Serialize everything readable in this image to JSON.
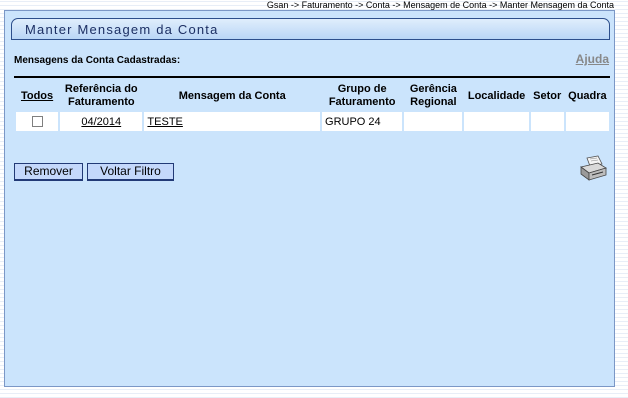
{
  "breadcrumb": "Gsan -> Faturamento -> Conta -> Mensagem de Conta -> Manter Mensagem da Conta",
  "title": "Manter Mensagem da Conta",
  "section_label": "Mensagens da Conta Cadastradas:",
  "help_label": "Ajuda",
  "table": {
    "headers": {
      "todos": "Todos",
      "referencia_1": "Referência do",
      "referencia_2": "Faturamento",
      "mensagem": "Mensagem da Conta",
      "grupo_1": "Grupo de",
      "grupo_2": "Faturamento",
      "gerencia_1": "Gerência",
      "gerencia_2": "Regional",
      "localidade": "Localidade",
      "setor": "Setor",
      "quadra": "Quadra"
    },
    "rows": [
      {
        "checked": false,
        "referencia": "04/2014",
        "mensagem": "TESTE",
        "grupo": "GRUPO 24",
        "gerencia": "",
        "localidade": "",
        "setor": "",
        "quadra": ""
      }
    ]
  },
  "buttons": {
    "remover": "Remover",
    "voltar_filtro": "Voltar Filtro"
  },
  "icons": {
    "print": "printer-icon"
  }
}
